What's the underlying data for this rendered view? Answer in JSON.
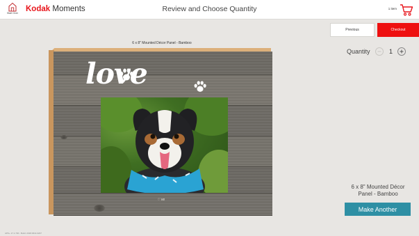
{
  "header": {
    "start_over_label": "Start Over",
    "brand_kodak": "Kodak",
    "brand_moments": "Moments",
    "title": "Review and Choose Quantity",
    "cart_count": "1 item",
    "cart_icon": "shopping-cart-icon",
    "home_icon": "home-icon"
  },
  "nav": {
    "previous_label": "Previous",
    "checkout_label": "Checkout"
  },
  "product": {
    "caption": "6 x 8\" Mounted Décor Panel - Bamboo",
    "love_text": "love",
    "signature_text": "♡ ve"
  },
  "quantity": {
    "label": "Quantity",
    "value": "1",
    "minus_icon": "minus-circle-icon",
    "plus_icon": "plus-circle-icon"
  },
  "summary": {
    "product_name": "6 x 8\" Mounted Décor Panel - Bamboo",
    "make_another_label": "Make Another"
  },
  "footer": {
    "build_info": "APK+ 17.1.700 - Build: 2018.0614.0207"
  },
  "colors": {
    "brand_red": "#e8151b",
    "checkout_red": "#ee1010",
    "accent_teal": "#2e8fa4",
    "background": "#e8e6e3"
  }
}
